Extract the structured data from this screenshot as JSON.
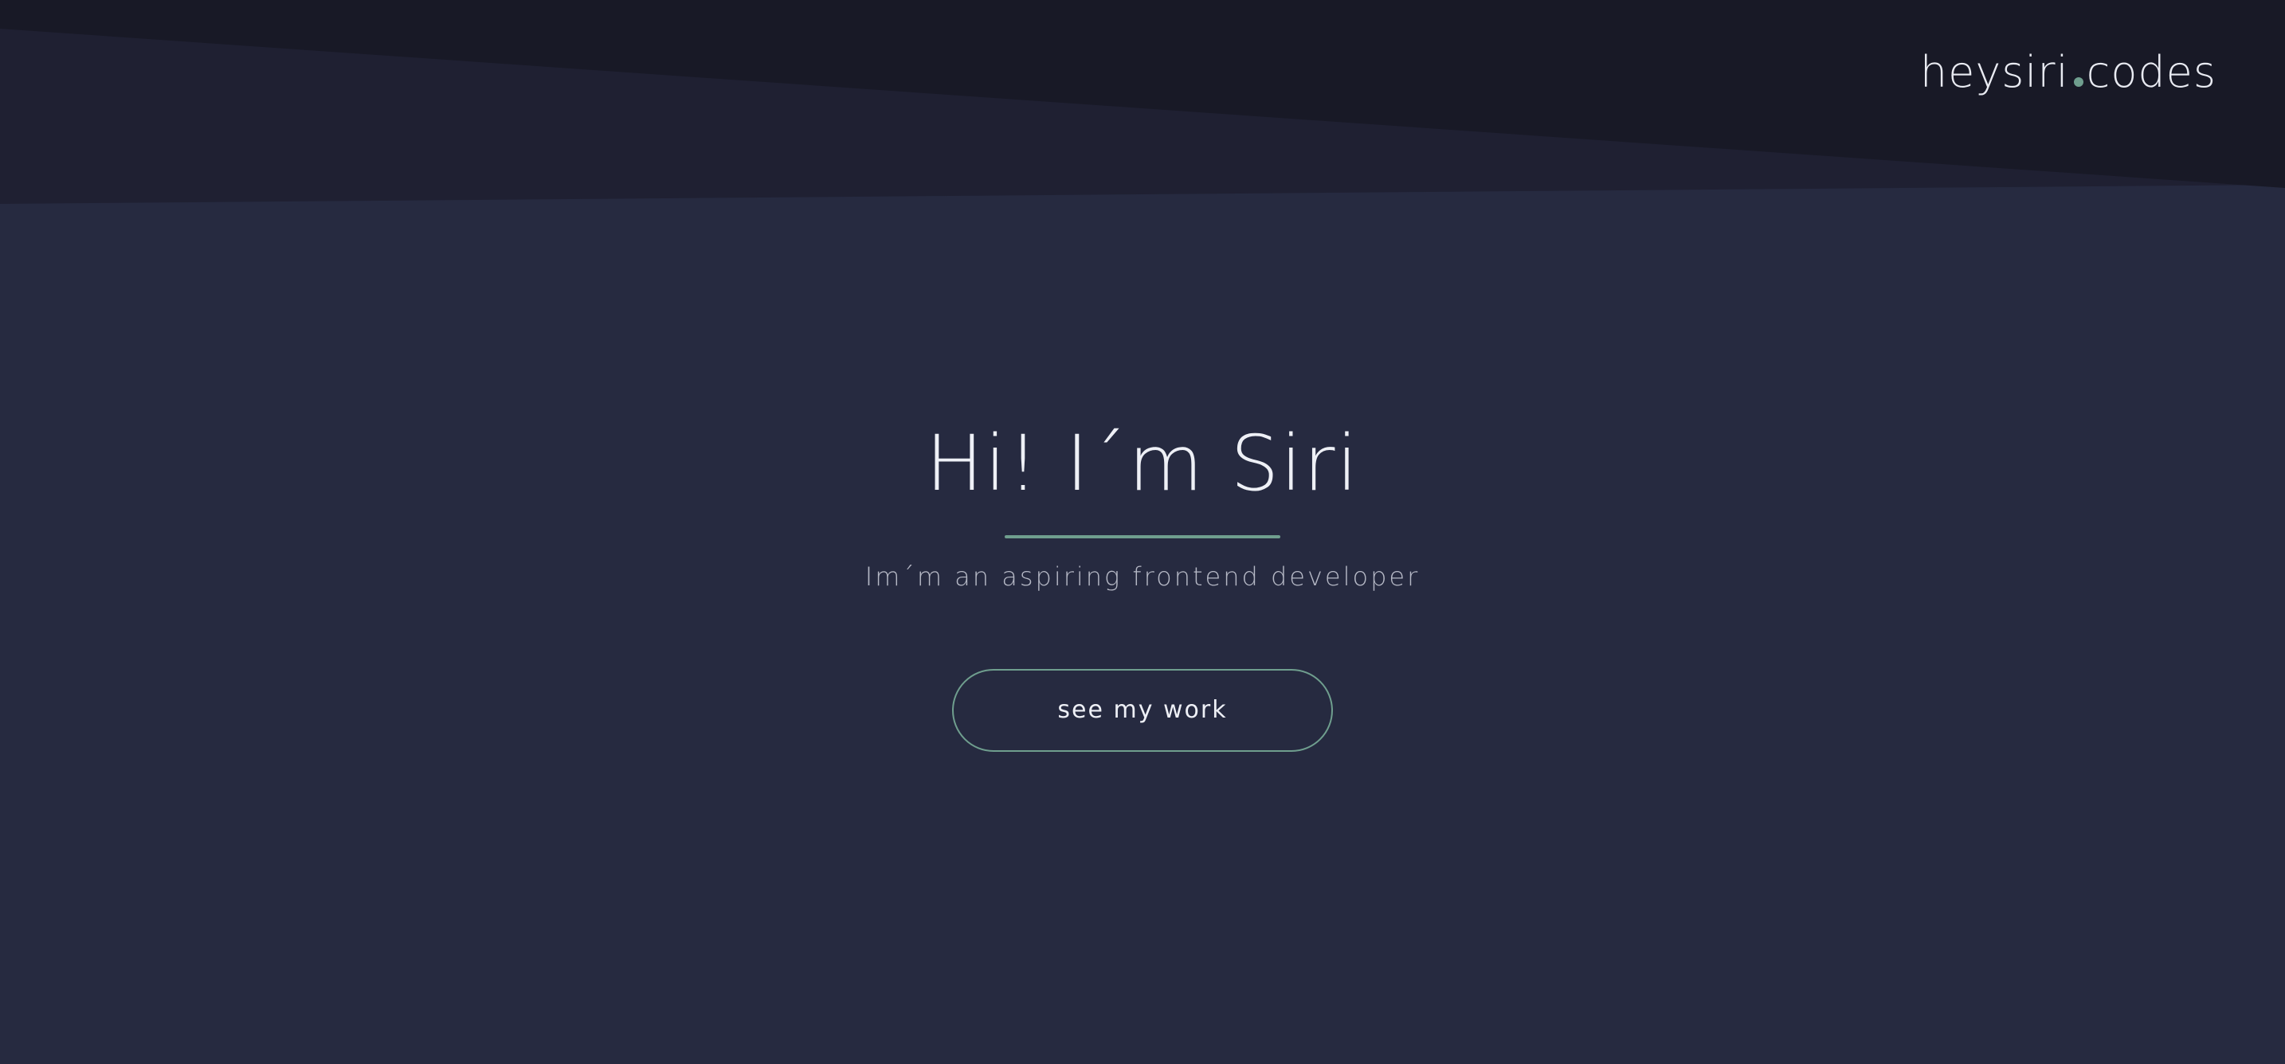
{
  "logo": {
    "name": "heysiri",
    "suffix": "codes"
  },
  "hero": {
    "title": "Hi! I´m Siri",
    "subtitle": "Im´m an aspiring frontend developer",
    "cta_label": "see my work"
  },
  "colors": {
    "background": "#262a40",
    "header_dark": "#181926",
    "header_mid": "#1f2032",
    "accent": "#6f9e8e",
    "text": "#eef0f6",
    "muted_text": "#b6b9c6"
  }
}
